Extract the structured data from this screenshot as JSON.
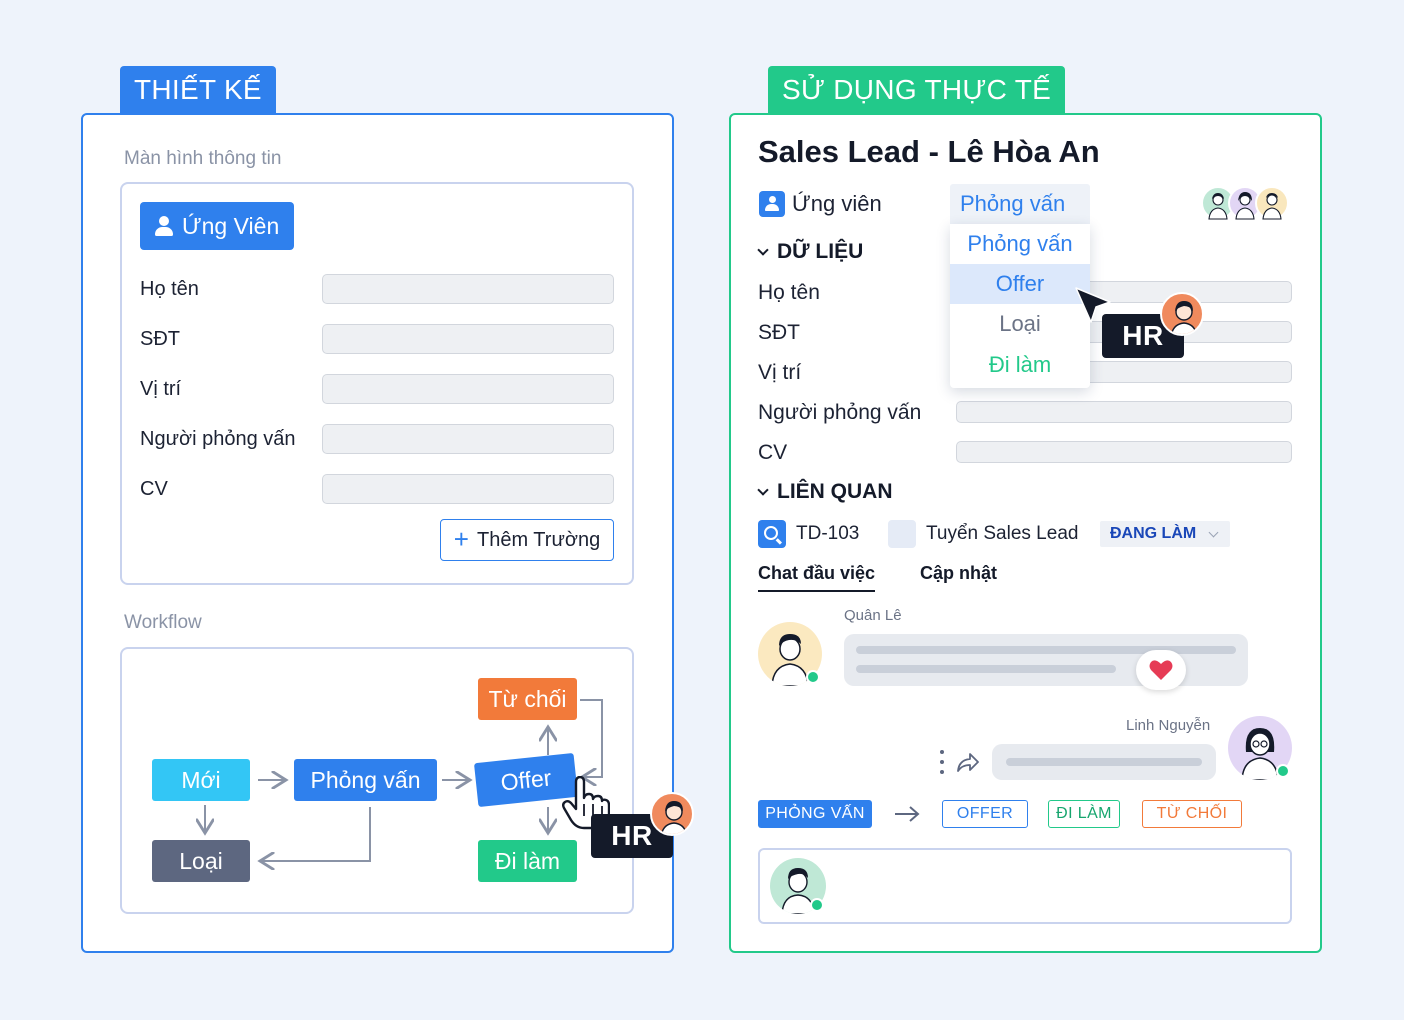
{
  "design": {
    "tab_label": "THIẾT KẾ",
    "info_screen_caption": "Màn hình thông tin",
    "candidate_button": "Ứng Viên",
    "fields": [
      "Họ tên",
      "SĐT",
      "Vị trí",
      "Người phỏng vấn",
      "CV"
    ],
    "add_field_button": "Thêm Trường",
    "workflow_caption": "Workflow",
    "workflow_nodes": {
      "new": "Mới",
      "interview": "Phỏng vấn",
      "offer": "Offer",
      "reject": "Từ chối",
      "drop": "Loại",
      "work": "Đi làm"
    },
    "hr_tag": "HR"
  },
  "real": {
    "tab_label": "SỬ DỤNG THỰC TẾ",
    "title": "Sales Lead - Lê Hòa An",
    "record_type": "Ứng viên",
    "dropdown": {
      "current": "Phỏng vấn",
      "options": [
        "Phỏng vấn",
        "Offer",
        "Loại",
        "Đi làm"
      ],
      "highlighted": "Offer"
    },
    "data_section": "DỮ LIỆU",
    "fields": [
      "Họ tên",
      "SĐT",
      "Vị trí",
      "Người phỏng vấn",
      "CV"
    ],
    "related_section": "LIÊN QUAN",
    "related": {
      "id": "TD-103",
      "name": "Tuyển Sales Lead",
      "status": "ĐANG LÀM"
    },
    "tabs": [
      "Chat đầu việc",
      "Cập nhật"
    ],
    "messages": [
      {
        "author": "Quân Lê",
        "reaction": "heart"
      },
      {
        "author": "Linh Nguyễn"
      }
    ],
    "status_flow": {
      "current": "PHỎNG VẤN",
      "next": [
        "OFFER",
        "ĐI LÀM",
        "TỪ CHỐI"
      ]
    },
    "hr_tag": "HR"
  },
  "colors": {
    "primary_blue": "#2f80ed",
    "green": "#22c98a",
    "orange": "#f27a3a",
    "cyan": "#33c6f5",
    "slate": "#5d6780",
    "dark": "#141a29"
  }
}
